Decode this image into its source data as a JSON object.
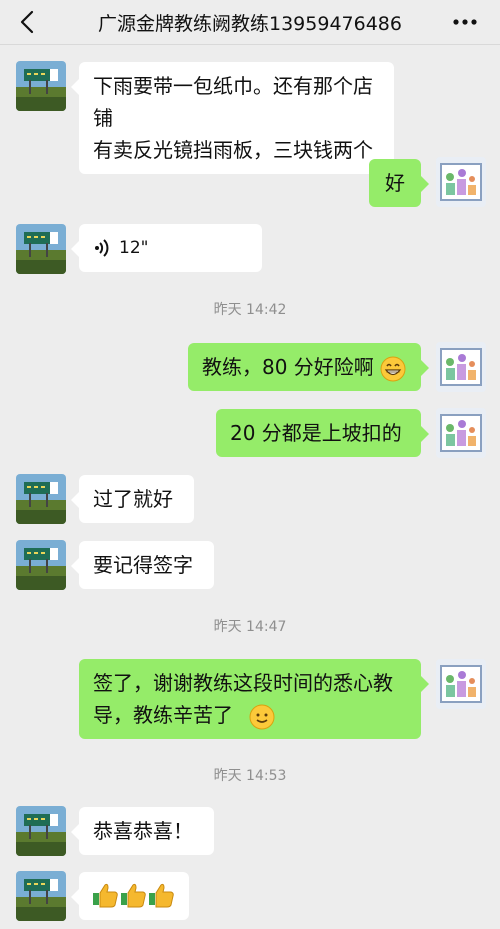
{
  "header": {
    "title": "广源金牌教练阙教练13959476486",
    "back_icon": "chevron-left-icon",
    "more_icon": "more-dots-icon"
  },
  "messages": [
    {
      "side": "in",
      "lines": [
        "下雨要带一包纸巾。还有那个店铺",
        "有卖反光镜挡雨板，三块钱两个"
      ]
    },
    {
      "side": "out",
      "text": "好"
    },
    {
      "side": "in",
      "type": "voice",
      "duration": "12\""
    },
    {
      "time": "昨天 14:42"
    },
    {
      "side": "out",
      "text": "教练，80 分好险啊",
      "emoji": "grin-emoji"
    },
    {
      "side": "out",
      "text": "20 分都是上坡扣的"
    },
    {
      "side": "in",
      "text": "过了就好"
    },
    {
      "side": "in",
      "text": "要记得签字"
    },
    {
      "time": "昨天 14:47"
    },
    {
      "side": "out",
      "lines": [
        "签了，谢谢教练这段时间的悉心教",
        "导，教练辛苦了"
      ],
      "emoji": "smile-emoji"
    },
    {
      "time": "昨天 14:53"
    },
    {
      "side": "in",
      "text": "恭喜恭喜！"
    },
    {
      "side": "in",
      "type": "emoji",
      "emoji": "thumbs-up-emoji",
      "count": 3
    }
  ],
  "colors": {
    "background": "#ededed",
    "outgoing_bubble": "#95ec69",
    "incoming_bubble": "#ffffff",
    "timestamp": "#8f8f8f"
  }
}
